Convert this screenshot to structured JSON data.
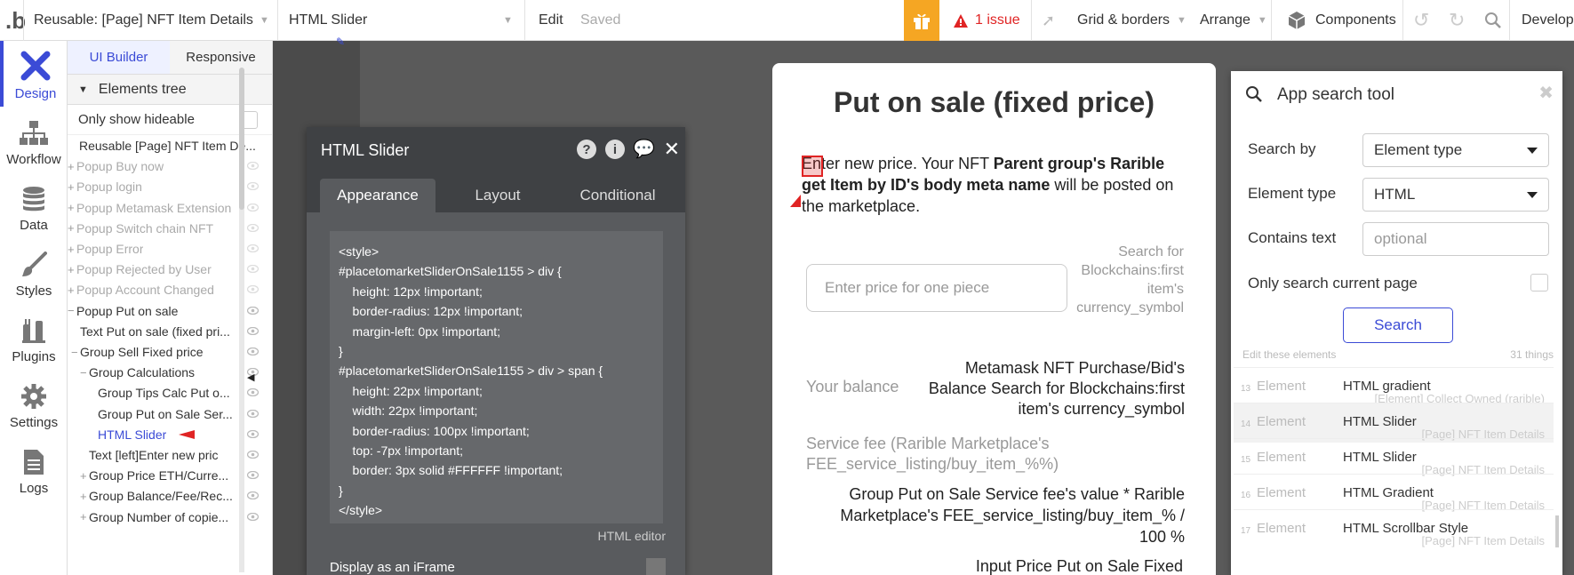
{
  "topbar": {
    "page_name": "Reusable: [Page] NFT Item Details",
    "element_name": "HTML Slider",
    "edit": "Edit",
    "saved": "Saved",
    "issues": "1 issue",
    "grid": "Grid & borders",
    "arrange": "Arrange",
    "components": "Components",
    "develop": "Develop",
    "accent": "#f5a623",
    "issue_color": "#e02424"
  },
  "leftnav": {
    "items": [
      {
        "label": "Design",
        "icon": "design-icon"
      },
      {
        "label": "Workflow",
        "icon": "workflow-icon"
      },
      {
        "label": "Data",
        "icon": "database-icon"
      },
      {
        "label": "Styles",
        "icon": "brush-icon"
      },
      {
        "label": "Plugins",
        "icon": "plug-icon"
      },
      {
        "label": "Settings",
        "icon": "gear-icon"
      },
      {
        "label": "Logs",
        "icon": "document-icon"
      }
    ]
  },
  "tree": {
    "tab_ui": "UI Builder",
    "tab_responsive": "Responsive",
    "section": "Elements tree",
    "hideable": "Only show hideable",
    "rows": [
      {
        "text": "Reusable [Page] NFT Item De...",
        "muted": false,
        "indent": 0,
        "plus": ""
      },
      {
        "text": "Popup Buy now",
        "muted": true,
        "indent": 0,
        "plus": "+"
      },
      {
        "text": "Popup login",
        "muted": true,
        "indent": 0,
        "plus": "+"
      },
      {
        "text": "Popup Metamask Extension",
        "muted": true,
        "indent": 0,
        "plus": "+"
      },
      {
        "text": "Popup Switch chain NFT",
        "muted": true,
        "indent": 0,
        "plus": "+"
      },
      {
        "text": "Popup Error",
        "muted": true,
        "indent": 0,
        "plus": "+"
      },
      {
        "text": "Popup Rejected by User",
        "muted": true,
        "indent": 0,
        "plus": "+"
      },
      {
        "text": "Popup Account Changed",
        "muted": true,
        "indent": 0,
        "plus": "+"
      },
      {
        "text": "Popup Put on sale",
        "muted": false,
        "indent": 0,
        "plus": "−"
      },
      {
        "text": "Text Put on sale (fixed pri...",
        "muted": false,
        "indent": 1,
        "plus": ""
      },
      {
        "text": "Group Sell Fixed price",
        "muted": false,
        "indent": 1,
        "plus": "−"
      },
      {
        "text": "Group Calculations",
        "muted": false,
        "indent": 2,
        "plus": "−"
      },
      {
        "text": "Group Tips Calc Put o...",
        "muted": false,
        "indent": 3,
        "plus": ""
      },
      {
        "text": "Group Put on Sale Ser...",
        "muted": false,
        "indent": 3,
        "plus": ""
      },
      {
        "text": "HTML Slider",
        "muted": false,
        "indent": 3,
        "plus": "",
        "selected": true
      },
      {
        "text": "Text [left]Enter new pric",
        "muted": false,
        "indent": 2,
        "plus": ""
      },
      {
        "text": "Group Price ETH/Curre...",
        "muted": false,
        "indent": 2,
        "plus": "+"
      },
      {
        "text": "Group Balance/Fee/Rec...",
        "muted": false,
        "indent": 2,
        "plus": "+"
      },
      {
        "text": "Group Number of copie...",
        "muted": false,
        "indent": 2,
        "plus": "+"
      }
    ]
  },
  "editor": {
    "title": "HTML Slider",
    "tabs": [
      "Appearance",
      "Layout",
      "Conditional"
    ],
    "code": "<style>\n#placetomarketSliderOnSale1155 > div {\n    height: 12px !important;\n    border-radius: 12px !important;\n    margin-left: 0px !important;\n}\n#placetomarketSliderOnSale1155 > div > span {\n    height: 22px !important;\n    width: 22px !important;\n    border-radius: 100px !important;\n    top: -7px !important;\n    border: 3px solid #FFFFFF !important;\n}\n</style>",
    "html_editor": "HTML editor",
    "iframe": "Display as an iFrame"
  },
  "popup": {
    "title": "Put on sale (fixed price)",
    "intro_a": "Enter new price. Your NFT ",
    "intro_b": "Parent group's Rarible get Item by ID's body meta name",
    "intro_c": " will be posted on the marketplace.",
    "price_placeholder": "Enter price for one piece",
    "currency": "Search for Blockchains:first item's currency_symbol",
    "balance_label": "Your balance",
    "balance_value": "Metamask NFT Purchase/Bid's Balance Search for Blockchains:first item's currency_symbol",
    "fee_label": "Service fee (Rarible Marketplace's FEE_service_listing/buy_item_%%)",
    "fee_value": "Group Put on Sale Service fee's value * Rarible Marketplace's FEE_service_listing/buy_item_% / 100 %",
    "input_value": "Input Price Put on Sale Fixed"
  },
  "search": {
    "title": "App search tool",
    "search_by_label": "Search by",
    "search_by_value": "Element type",
    "element_type_label": "Element type",
    "element_type_value": "HTML",
    "contains_label": "Contains text",
    "contains_placeholder": "optional",
    "only_page": "Only search current page",
    "button": "Search",
    "edit_these": "Edit these elements",
    "count": "31 things",
    "results": [
      {
        "n": "13",
        "type": "Element",
        "name": "HTML gradient",
        "sub": "[Element] Collect Owned (rarible)"
      },
      {
        "n": "14",
        "type": "Element",
        "name": "HTML Slider",
        "sub": "[Page] NFT Item Details"
      },
      {
        "n": "15",
        "type": "Element",
        "name": "HTML Slider",
        "sub": "[Page] NFT Item Details"
      },
      {
        "n": "16",
        "type": "Element",
        "name": "HTML Gradient",
        "sub": "[Page] NFT Item Details"
      },
      {
        "n": "17",
        "type": "Element",
        "name": "HTML Scrollbar Style",
        "sub": "[Page] NFT Item Details"
      }
    ]
  }
}
